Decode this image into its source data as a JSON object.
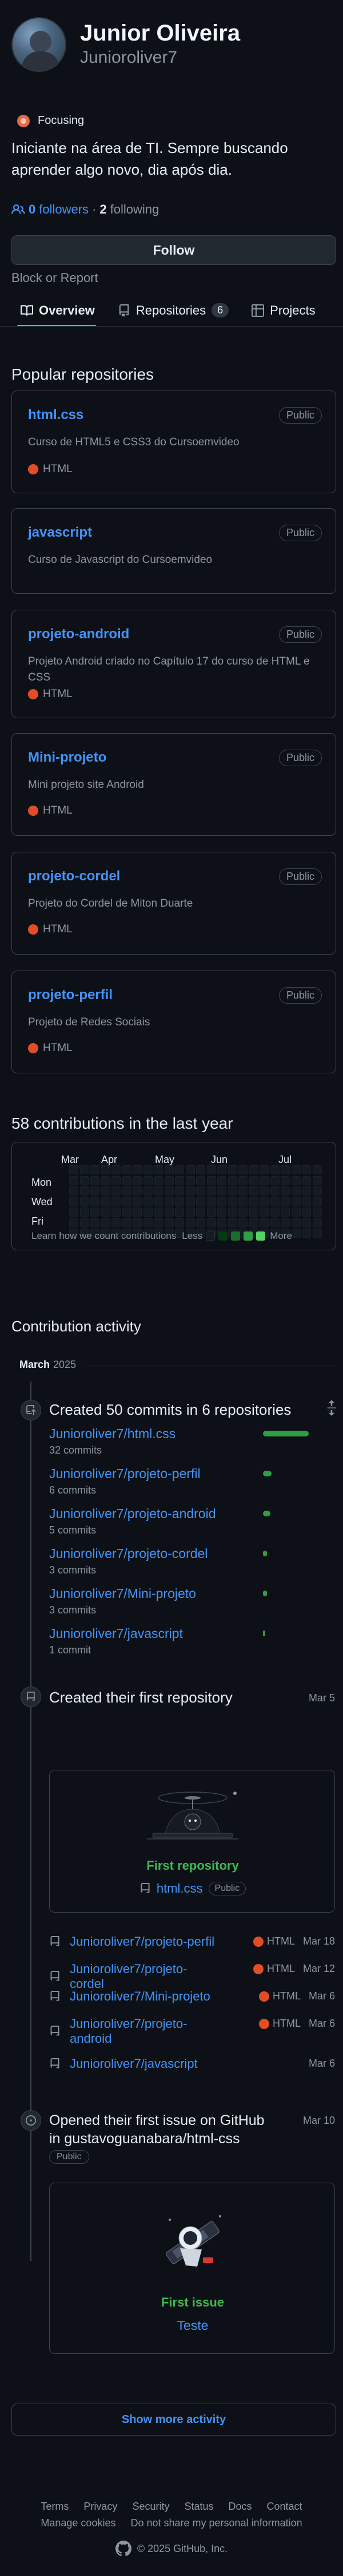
{
  "profile": {
    "name": "Junior Oliveira",
    "login": "Junioroliver7",
    "status": "Focusing",
    "bio": "Iniciante na área de TI. Sempre buscando aprender algo novo, dia após dia.",
    "followers_count": "0",
    "followers_label": "followers",
    "separator": "·",
    "following_count": "2",
    "following_label": "following",
    "follow_button": "Follow",
    "block_link": "Block or Report"
  },
  "tabs": [
    {
      "label": "Overview",
      "icon": "book-icon",
      "active": true
    },
    {
      "label": "Repositories",
      "icon": "repo-icon",
      "count": "6"
    },
    {
      "label": "Projects",
      "icon": "table-icon"
    }
  ],
  "popular": {
    "title": "Popular repositories",
    "repos": [
      {
        "name": "html.css",
        "visibility": "Public",
        "description": "Curso de HTML5 e CSS3 do Cursoemvideo",
        "language": "HTML"
      },
      {
        "name": "javascript",
        "visibility": "Public",
        "description": "Curso de Javascript do Cursoemvideo",
        "language": ""
      },
      {
        "name": "projeto-android",
        "visibility": "Public",
        "description": "Projeto Android criado no Capítulo 17 do curso de HTML e CSS",
        "language": "HTML"
      },
      {
        "name": "Mini-projeto",
        "visibility": "Public",
        "description": "Mini projeto site Android",
        "language": "HTML"
      },
      {
        "name": "projeto-cordel",
        "visibility": "Public",
        "description": "Projeto do Cordel de Miton Duarte",
        "language": "HTML"
      },
      {
        "name": "projeto-perfil",
        "visibility": "Public",
        "description": "Projeto de Redes Sociais",
        "language": "HTML"
      }
    ]
  },
  "contributions": {
    "title": "58 contributions in the last year",
    "months": [
      "Mar",
      "Apr",
      "May",
      "Jun",
      "Jul"
    ],
    "days": [
      "Mon",
      "Wed",
      "Fri"
    ],
    "learn_more": "Learn how we count contributions",
    "less": "Less",
    "more": "More",
    "colors": [
      "#151b23",
      "#033a16",
      "#196c2e",
      "#2ea043",
      "#56d364"
    ]
  },
  "activity": {
    "title": "Contribution activity",
    "month": "March",
    "year": "2025",
    "commits": {
      "title": "Created 50 commits in 6 repositories",
      "rows": [
        {
          "repo": "Junioroliver7/html.css",
          "count": "32 commits",
          "share": 1.0
        },
        {
          "repo": "Junioroliver7/projeto-perfil",
          "count": "6 commits",
          "share": 0.19
        },
        {
          "repo": "Junioroliver7/projeto-android",
          "count": "5 commits",
          "share": 0.16
        },
        {
          "repo": "Junioroliver7/projeto-cordel",
          "count": "3 commits",
          "share": 0.09
        },
        {
          "repo": "Junioroliver7/Mini-projeto",
          "count": "3 commits",
          "share": 0.09
        },
        {
          "repo": "Junioroliver7/javascript",
          "count": "1 commit",
          "share": 0.03
        }
      ]
    },
    "first_repo": {
      "title": "Created their first repository",
      "date": "Mar 5",
      "card_label": "First repository",
      "repo": "html.css",
      "visibility": "Public"
    },
    "created_repos": [
      {
        "repo": "Junioroliver7/projeto-perfil",
        "language": "HTML",
        "date": "Mar 18"
      },
      {
        "repo": "Junioroliver7/projeto-cordel",
        "language": "HTML",
        "date": "Mar 12"
      },
      {
        "repo": "Junioroliver7/Mini-projeto",
        "language": "HTML",
        "date": "Mar 6"
      },
      {
        "repo": "Junioroliver7/projeto-android",
        "language": "HTML",
        "date": "Mar 6"
      },
      {
        "repo": "Junioroliver7/javascript",
        "language": "",
        "date": "Mar 6"
      }
    ],
    "first_issue": {
      "title": "Opened their first issue on GitHub in gustavoguanabara/html-css",
      "visibility": "Public",
      "date": "Mar 10",
      "card_label": "First issue",
      "issue": "Teste"
    },
    "show_more": "Show more activity"
  },
  "footer": {
    "links": [
      "Terms",
      "Privacy",
      "Security",
      "Status",
      "Docs",
      "Contact",
      "Manage cookies",
      "Do not share my personal information"
    ],
    "copyright": "© 2025 GitHub, Inc."
  }
}
